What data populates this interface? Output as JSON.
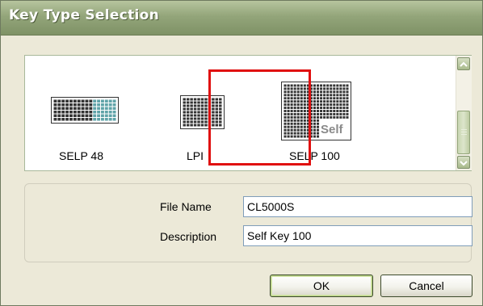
{
  "window": {
    "title": "Key Type Selection"
  },
  "key_list": {
    "items": [
      {
        "label": "SELP 48",
        "icon": "keyboard-48-icon"
      },
      {
        "label": "LPI",
        "icon": "keyboard-lpi-icon"
      },
      {
        "label": "SELP 100",
        "icon": "keyboard-100-icon",
        "badge": "Self"
      }
    ],
    "selected_index": 1
  },
  "file": {
    "name_label": "File Name",
    "name_value": "CL5000S",
    "description_label": "Description",
    "description_value": "Self Key 100"
  },
  "buttons": {
    "ok_label": "OK",
    "cancel_label": "Cancel"
  },
  "colors": {
    "title_bar": "#93A57A",
    "selection": "#E01010",
    "dialog_bg": "#ECE9D8"
  }
}
